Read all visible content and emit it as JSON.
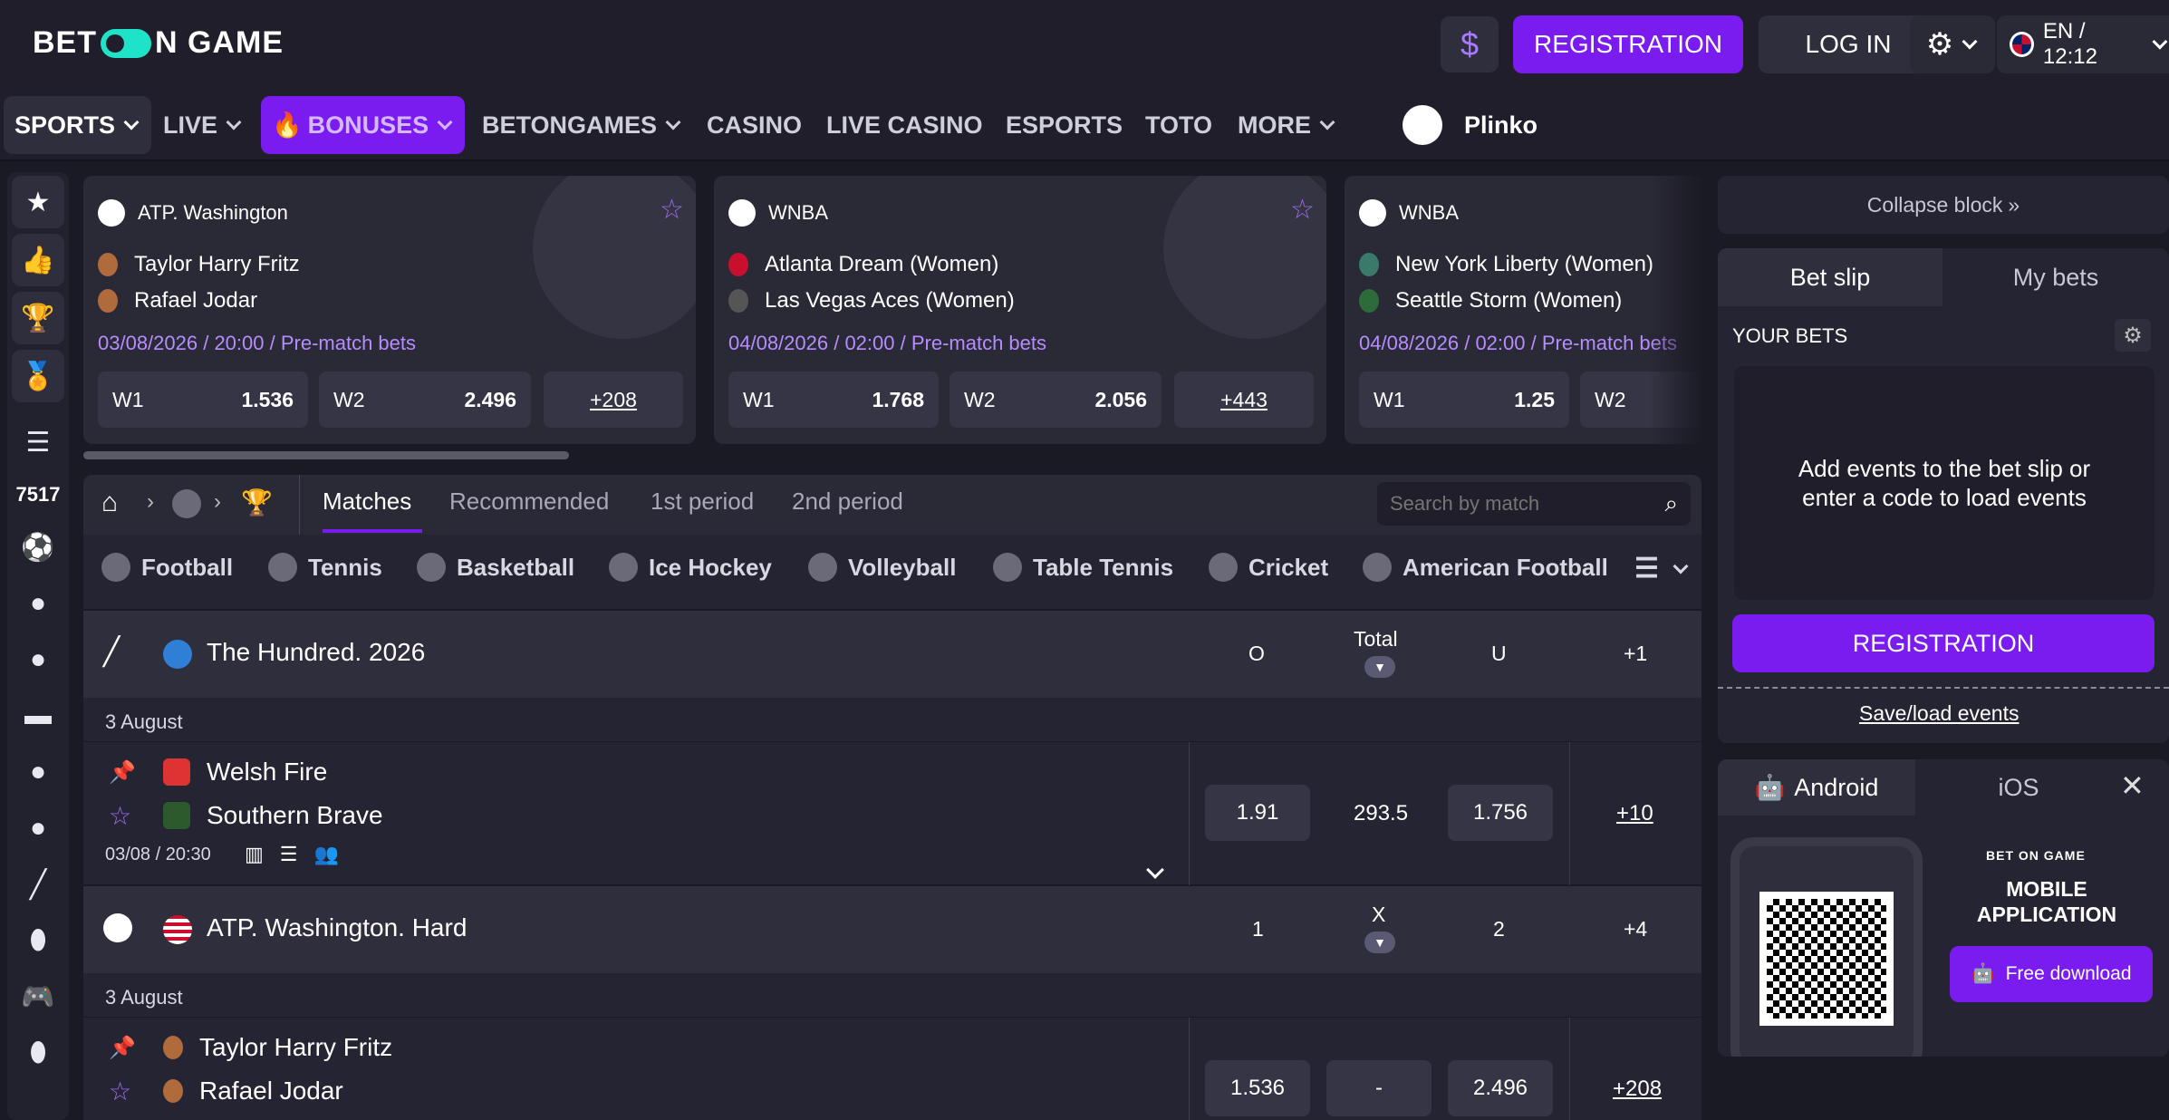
{
  "header": {
    "logo": "BET ON GAME",
    "currency_icon": "$",
    "registration": "REGISTRATION",
    "login": "LOG IN",
    "lang_time": "EN / 12:12"
  },
  "nav": {
    "sports": "SPORTS",
    "live": "LIVE",
    "bonuses": "BONUSES",
    "betongames": "BETONGAMES",
    "casino": "CASINO",
    "live_casino": "LIVE CASINO",
    "esports": "ESPORTS",
    "toto": "TOTO",
    "more": "MORE",
    "plinko": "Plinko"
  },
  "sidebar": {
    "count": "7517"
  },
  "cards": [
    {
      "league": "ATP. Washington",
      "team1": "Taylor Harry Fritz",
      "team2": "Rafael Jodar",
      "datetime": "03/08/2026 / 20:00 / Pre-match bets",
      "w1_label": "W1",
      "w1": "1.536",
      "w2_label": "W2",
      "w2": "2.496",
      "more": "+208"
    },
    {
      "league": "WNBA",
      "team1": "Atlanta Dream (Women)",
      "team2": "Las Vegas Aces (Women)",
      "datetime": "04/08/2026 / 02:00 / Pre-match bets",
      "w1_label": "W1",
      "w1": "1.768",
      "w2_label": "W2",
      "w2": "2.056",
      "more": "+443"
    },
    {
      "league": "WNBA",
      "team1": "New York Liberty (Women)",
      "team2": "Seattle Storm (Women)",
      "datetime": "04/08/2026 / 02:00 / Pre-match bets",
      "w1_label": "W1",
      "w1": "1.25",
      "w2_label": "W2"
    }
  ],
  "tabs": {
    "matches": "Matches",
    "recommended": "Recommended",
    "first": "1st period",
    "second": "2nd period",
    "search_placeholder": "Search by match"
  },
  "sports": [
    "Football",
    "Tennis",
    "Basketball",
    "Ice Hockey",
    "Volleyball",
    "Table Tennis",
    "Cricket",
    "American Football"
  ],
  "leagues": [
    {
      "name": "The Hundred. 2026",
      "c1": "O",
      "c2": "Total",
      "c3": "U",
      "more": "+1",
      "date": "3 August",
      "match": {
        "team1": "Welsh Fire",
        "team2": "Southern Brave",
        "time": "03/08 / 20:30",
        "o1": "1.91",
        "o2": "293.5",
        "o3": "1.756",
        "more": "+10"
      }
    },
    {
      "name": "ATP. Washington. Hard",
      "c1": "1",
      "c2": "X",
      "c3": "2",
      "more": "+4",
      "date": "3 August",
      "match": {
        "team1": "Taylor Harry Fritz",
        "team2": "Rafael Jodar",
        "o1": "1.536",
        "o2": "-",
        "o3": "2.496",
        "more": "+208"
      }
    }
  ],
  "betslip": {
    "collapse": "Collapse block",
    "tab1": "Bet slip",
    "tab2": "My bets",
    "your_bets": "YOUR BETS",
    "empty": "Add events to the bet slip or enter a code to load events",
    "registration": "REGISTRATION",
    "save": "Save/load events"
  },
  "app": {
    "android": "Android",
    "ios": "iOS",
    "logo": "BET ON GAME",
    "title": "MOBILE APPLICATION",
    "download": "Free download"
  },
  "colors": {
    "accent": "#7a1cf0",
    "bg": "#1a1a24",
    "panel": "#252432",
    "date": "#b68cff"
  }
}
